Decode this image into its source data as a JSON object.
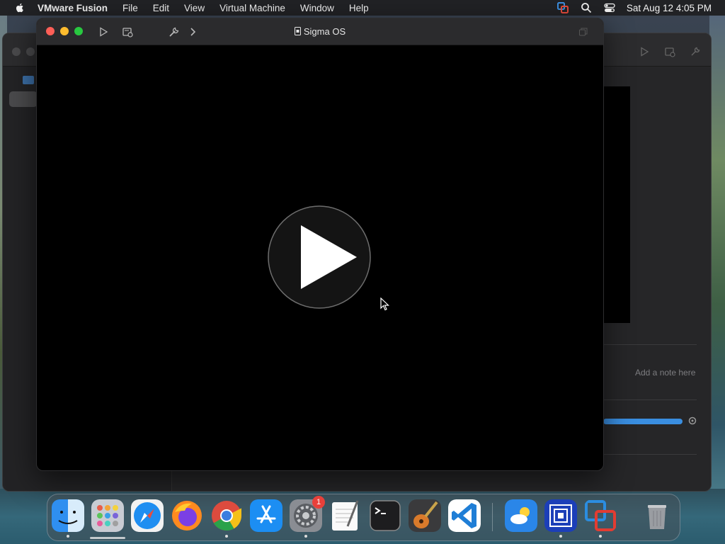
{
  "menubar": {
    "app_name": "VMware Fusion",
    "menus": [
      "File",
      "Edit",
      "View",
      "Virtual Machine",
      "Window",
      "Help"
    ],
    "clock": "Sat Aug 12  4:05 PM",
    "status_icons": [
      "vmware-status-icon",
      "spotlight-search-icon",
      "control-center-icon"
    ]
  },
  "vm_window": {
    "title": "Sigma OS",
    "toolbar_icons": [
      "play-icon",
      "snapshot-icon",
      "settings-wrench-icon",
      "chevron-right-icon",
      "restore-window-icon"
    ]
  },
  "library_window": {
    "note_placeholder": "Add a note here"
  },
  "dock": {
    "apps": [
      "Finder",
      "Launchpad",
      "Safari",
      "Firefox",
      "Chrome",
      "App Store",
      "System Settings",
      "TextEdit",
      "Terminal",
      "GarageBand",
      "Visual Studio Code",
      "Weather",
      "Remote Desktop",
      "VMware Fusion",
      "Trash"
    ],
    "system_settings_badge": "1"
  },
  "colors": {
    "accent_blue": "#3a8ee0",
    "close_red": "#fe5f57",
    "minimize_yellow": "#febc2e",
    "zoom_green": "#28c840"
  }
}
